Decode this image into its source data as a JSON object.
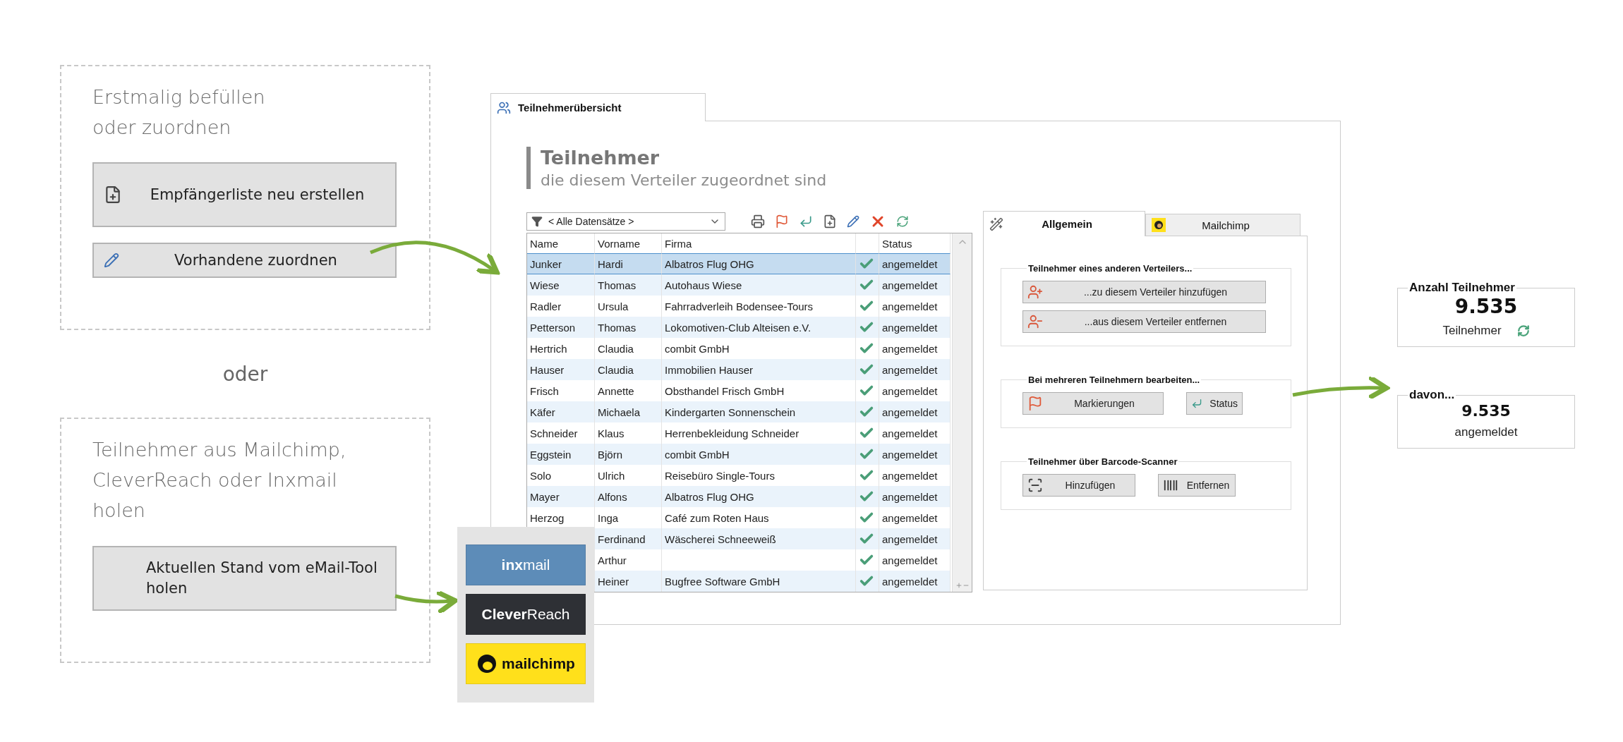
{
  "left": {
    "panels": [
      {
        "text": "Erstmalig befüllen oder zuordnen",
        "buttons": [
          {
            "label": "Empfängerliste neu erstellen"
          },
          {
            "label": "Vorhandene zuordnen"
          }
        ]
      },
      {
        "text": "Teilnehmer aus Mailchimp, CleverReach oder Inxmail holen",
        "buttons": [
          {
            "label": "Aktuellen Stand vom eMail-Tool holen"
          }
        ]
      }
    ],
    "separator": "oder"
  },
  "window": {
    "tab": "Teilnehmerübersicht",
    "title": "Teilnehmer",
    "subtitle": "die diesem Verteiler zugeordnet sind",
    "filter": {
      "value": "< Alle Datensätze >"
    },
    "table": {
      "columns": [
        "Name",
        "Vorname",
        "Firma",
        "Status"
      ],
      "rows": [
        {
          "name": "Junker",
          "vorname": "Hardi",
          "firma": "Albatros Flug OHG",
          "checked": true,
          "status": "angemeldet",
          "selected": true
        },
        {
          "name": "Wiese",
          "vorname": "Thomas",
          "firma": "Autohaus Wiese",
          "checked": true,
          "status": "angemeldet",
          "selected": false
        },
        {
          "name": "Radler",
          "vorname": "Ursula",
          "firma": "Fahrradverleih Bodensee-Tours",
          "checked": true,
          "status": "angemeldet",
          "selected": false
        },
        {
          "name": "Petterson",
          "vorname": "Thomas",
          "firma": "Lokomotiven-Club Alteisen e.V.",
          "checked": true,
          "status": "angemeldet",
          "selected": false
        },
        {
          "name": "Hertrich",
          "vorname": "Claudia",
          "firma": "combit GmbH",
          "checked": true,
          "status": "angemeldet",
          "selected": false
        },
        {
          "name": "Hauser",
          "vorname": "Claudia",
          "firma": "Immobilien Hauser",
          "checked": true,
          "status": "angemeldet",
          "selected": false
        },
        {
          "name": "Frisch",
          "vorname": "Annette",
          "firma": "Obsthandel Frisch GmbH",
          "checked": true,
          "status": "angemeldet",
          "selected": false
        },
        {
          "name": "Käfer",
          "vorname": "Michaela",
          "firma": "Kindergarten Sonnenschein",
          "checked": true,
          "status": "angemeldet",
          "selected": false
        },
        {
          "name": "Schneider",
          "vorname": "Klaus",
          "firma": "Herrenbekleidung Schneider",
          "checked": true,
          "status": "angemeldet",
          "selected": false
        },
        {
          "name": "Eggstein",
          "vorname": "Björn",
          "firma": "combit GmbH",
          "checked": true,
          "status": "angemeldet",
          "selected": false
        },
        {
          "name": "Solo",
          "vorname": "Ulrich",
          "firma": "Reisebüro Single-Tours",
          "checked": true,
          "status": "angemeldet",
          "selected": false
        },
        {
          "name": "Mayer",
          "vorname": "Alfons",
          "firma": "Albatros Flug OHG",
          "checked": true,
          "status": "angemeldet",
          "selected": false
        },
        {
          "name": "Herzog",
          "vorname": "Inga",
          "firma": "Café zum Roten Haus",
          "checked": true,
          "status": "angemeldet",
          "selected": false
        },
        {
          "vorname": "Ferdinand",
          "firma": "Wäscherei Schneeweiß",
          "checked": true,
          "status": "angemeldet",
          "selected": false
        },
        {
          "vorname": "Arthur",
          "checked": true,
          "status": "angemeldet",
          "selected": false
        },
        {
          "vorname": "Heiner",
          "firma": "Bugfree Software GmbH",
          "checked": true,
          "status": "angemeldet",
          "selected": false
        }
      ]
    },
    "side": {
      "tabs": [
        {
          "label": "Allgemein",
          "selected": true
        },
        {
          "label": "Mailchimp",
          "selected": false
        }
      ],
      "groups": [
        {
          "legend": "Teilnehmer eines anderen Verteilers...",
          "buttons": [
            "...zu diesem Verteiler hinzufügen",
            "...aus diesem Verteiler entfernen"
          ]
        },
        {
          "legend": "Bei mehreren Teilnehmern bearbeiten...",
          "buttons": [
            "Markierungen",
            "Status"
          ]
        },
        {
          "legend": "Teilnehmer über Barcode-Scanner",
          "buttons": [
            "Hinzufügen",
            "Entfernen"
          ]
        }
      ]
    }
  },
  "counts": [
    {
      "legend": "Anzahl Teilnehmer",
      "value": "9.535",
      "label": "Teilnehmer"
    },
    {
      "legend": "davon...",
      "value": "9.535",
      "label": "angemeldet"
    }
  ],
  "logos": [
    {
      "text": "**inx**mail",
      "color": "#5d8cb8"
    },
    {
      "text": "**Clever**Reach",
      "color": "#2e3035"
    },
    {
      "text": "**mailchimp**",
      "color": "#ffe01b"
    }
  ]
}
